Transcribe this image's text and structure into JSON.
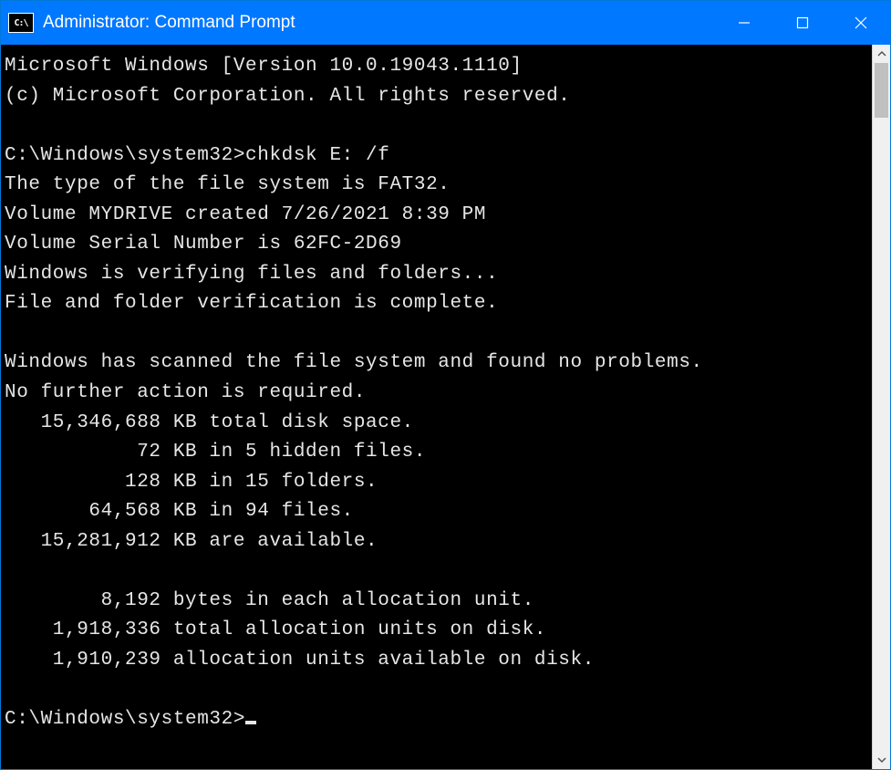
{
  "window": {
    "title": "Administrator: Command Prompt"
  },
  "terminal": {
    "lines": [
      "Microsoft Windows [Version 10.0.19043.1110]",
      "(c) Microsoft Corporation. All rights reserved.",
      "",
      "C:\\Windows\\system32>chkdsk E: /f",
      "The type of the file system is FAT32.",
      "Volume MYDRIVE created 7/26/2021 8:39 PM",
      "Volume Serial Number is 62FC-2D69",
      "Windows is verifying files and folders...",
      "File and folder verification is complete.",
      "",
      "Windows has scanned the file system and found no problems.",
      "No further action is required.",
      "   15,346,688 KB total disk space.",
      "           72 KB in 5 hidden files.",
      "          128 KB in 15 folders.",
      "       64,568 KB in 94 files.",
      "   15,281,912 KB are available.",
      "",
      "        8,192 bytes in each allocation unit.",
      "    1,918,336 total allocation units on disk.",
      "    1,910,239 allocation units available on disk.",
      "",
      "C:\\Windows\\system32>"
    ]
  }
}
